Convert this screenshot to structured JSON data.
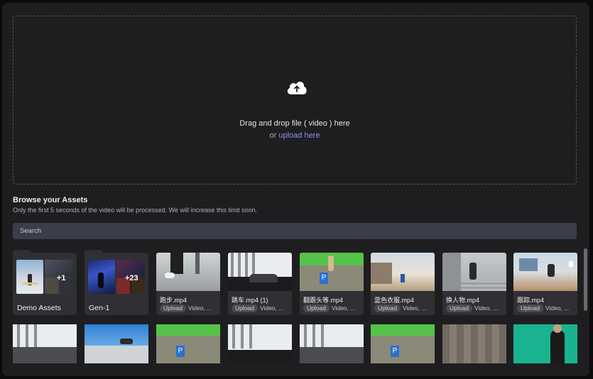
{
  "dropzone": {
    "title": "Drag and drop file ( video ) here",
    "or_text": "or",
    "upload_link": "upload here",
    "icon": "cloud-upload-icon"
  },
  "browse": {
    "title": "Browse your Assets",
    "subtitle": "Only the first 5 seconds of the video will be processed. We will increase this limit soon."
  },
  "search": {
    "placeholder": "Search"
  },
  "folders": [
    {
      "label": "Demo Assets",
      "extra_count": "+1"
    },
    {
      "label": "Gen-1",
      "extra_count": "+23"
    }
  ],
  "assets": [
    {
      "name": "跑步.mp4",
      "tag": "Upload",
      "type": "Video, ..."
    },
    {
      "name": "跳车.mp4 (1)",
      "tag": "Upload",
      "type": "Video, ..."
    },
    {
      "name": "翻跟头等.mp4",
      "tag": "Upload",
      "type": "Video, ..."
    },
    {
      "name": "蓝色衣服.mp4",
      "tag": "Upload",
      "type": "Video, ..."
    },
    {
      "name": "换人物.mp4",
      "tag": "Upload",
      "type": "Video, ..."
    },
    {
      "name": "跟踪.mp4",
      "tag": "Upload",
      "type": "Video, ..."
    }
  ]
}
